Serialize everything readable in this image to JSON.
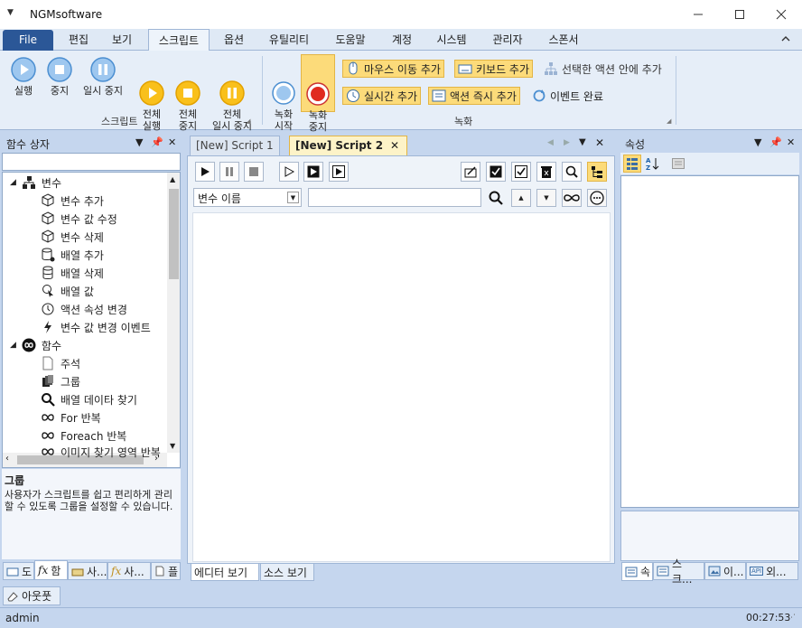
{
  "window": {
    "title": "NGMsoftware",
    "menu_glyph": "▼",
    "controls": [
      "minimize",
      "maximize",
      "close"
    ]
  },
  "ribbon": {
    "tabs": [
      {
        "label": "File"
      },
      {
        "label": "편집"
      },
      {
        "label": "보기"
      },
      {
        "label": "스크립트"
      },
      {
        "label": "옵션"
      },
      {
        "label": "유틸리티"
      },
      {
        "label": "도움말"
      },
      {
        "label": "계정"
      },
      {
        "label": "시스템"
      },
      {
        "label": "관리자"
      },
      {
        "label": "스폰서"
      }
    ],
    "script_group": {
      "label": "스크립트",
      "buttons": [
        {
          "label": "실행",
          "icon": "play-icon"
        },
        {
          "label": "중지",
          "icon": "stop-icon"
        },
        {
          "label": "일시 중지",
          "icon": "pause-icon"
        },
        {
          "label": "전체\n실행",
          "icon": "play-all-icon"
        },
        {
          "label": "전체\n중지",
          "icon": "stop-all-icon"
        },
        {
          "label": "전체\n일시 중지",
          "icon": "pause-all-icon"
        }
      ]
    },
    "record_group": {
      "label": "녹화",
      "record_start": "녹화\n시작",
      "record_stop": "녹화\n중지",
      "mouse_move": "마우스 이동 추가",
      "keyboard": "키보드 추가",
      "in_selected": "선택한 액션 안에 추가",
      "realtime": "실시간 추가",
      "action_now": "액션 즉시 추가",
      "event_done": "이벤트 완료"
    }
  },
  "function_box": {
    "title": "함수 상자",
    "tree": [
      {
        "label": "변수",
        "level": 0,
        "icon": "variable-group-icon"
      },
      {
        "label": "변수 추가",
        "level": 1,
        "icon": "cube-add-icon"
      },
      {
        "label": "변수 값 수정",
        "level": 1,
        "icon": "cube-edit-icon"
      },
      {
        "label": "변수 삭제",
        "level": 1,
        "icon": "cube-delete-icon"
      },
      {
        "label": "배열 추가",
        "level": 1,
        "icon": "database-add-icon"
      },
      {
        "label": "배열 삭제",
        "level": 1,
        "icon": "database-delete-icon"
      },
      {
        "label": "배열 값",
        "level": 1,
        "icon": "pointer-icon"
      },
      {
        "label": "액션 속성 변경",
        "level": 1,
        "icon": "clock-icon"
      },
      {
        "label": "변수 값 변경 이벤트",
        "level": 1,
        "icon": "bolt-icon"
      },
      {
        "label": "함수",
        "level": 0,
        "icon": "infinity-circle-icon"
      },
      {
        "label": "주석",
        "level": 1,
        "icon": "note-icon"
      },
      {
        "label": "그룹",
        "level": 1,
        "icon": "stack-icon"
      },
      {
        "label": "배열 데이타 찾기",
        "level": 1,
        "icon": "search-icon"
      },
      {
        "label": "For 반복",
        "level": 1,
        "icon": "infinity-icon"
      },
      {
        "label": "Foreach 반복",
        "level": 1,
        "icon": "infinity-icon"
      },
      {
        "label": "이미지 찾기 영역 반복",
        "level": 1,
        "icon": "image-loop-icon"
      }
    ],
    "desc_title": "그룹",
    "desc_text": "사용자가 스크립트를 쉽고 편리하게 관리할 수 있도록 그룹을 설정할 수 있습니다.",
    "bottom_tabs": [
      "도",
      "함",
      "사...",
      "사...",
      "플"
    ]
  },
  "editor": {
    "tabs": [
      {
        "label": "[New] Script 1"
      },
      {
        "label": "[New] Script 2"
      }
    ],
    "variable_select": "변수 이름",
    "bottom_tabs": [
      "에디터 보기",
      "소스 보기"
    ]
  },
  "properties": {
    "title": "속성",
    "bottom_tabs": [
      "속",
      "스크...",
      "이...",
      "외..."
    ]
  },
  "output_tab": "아웃풋",
  "status": {
    "user": "admin",
    "time": "00:27:53"
  }
}
